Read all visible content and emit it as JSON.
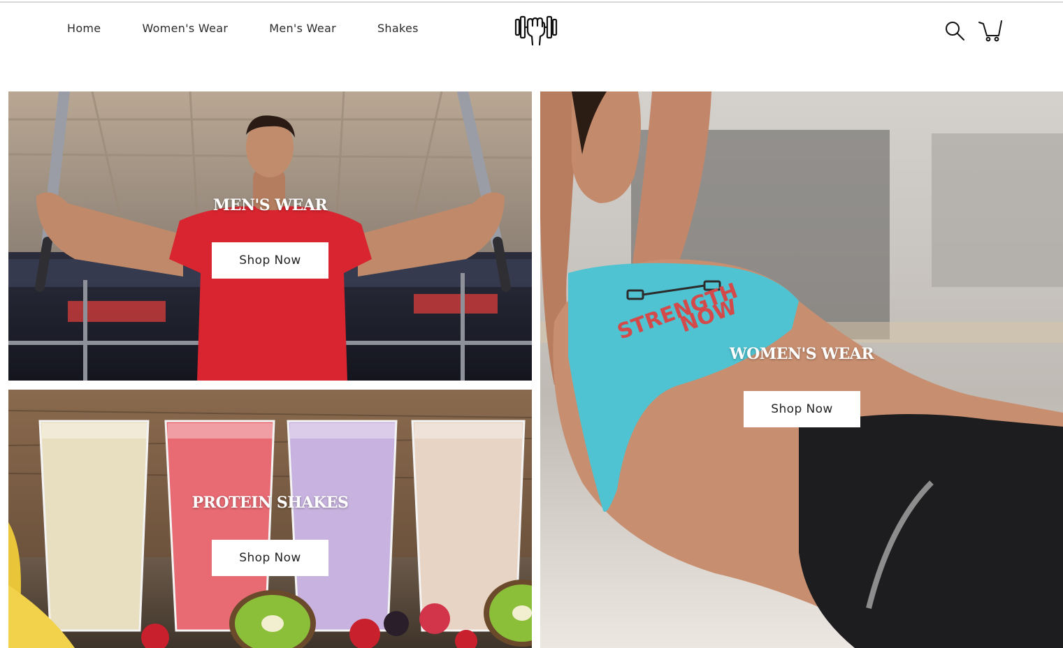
{
  "header": {
    "nav": [
      {
        "label": "Home"
      },
      {
        "label": "Women's Wear"
      },
      {
        "label": "Men's Wear"
      },
      {
        "label": "Shakes"
      }
    ],
    "logo_icon": "dumbbell-fist-icon",
    "search_icon": "search-icon",
    "cart_icon": "cart-icon"
  },
  "tiles": {
    "men": {
      "title": "MEN'S WEAR",
      "button": "Shop Now",
      "shirt_color": "#d8252f"
    },
    "shakes": {
      "title": "PROTEIN SHAKES",
      "button": "Shop Now"
    },
    "women": {
      "title": "WOMEN'S WEAR",
      "button": "Shop Now",
      "top_color": "#4fc3d1",
      "print_text": "STRENGTH NOW"
    }
  }
}
